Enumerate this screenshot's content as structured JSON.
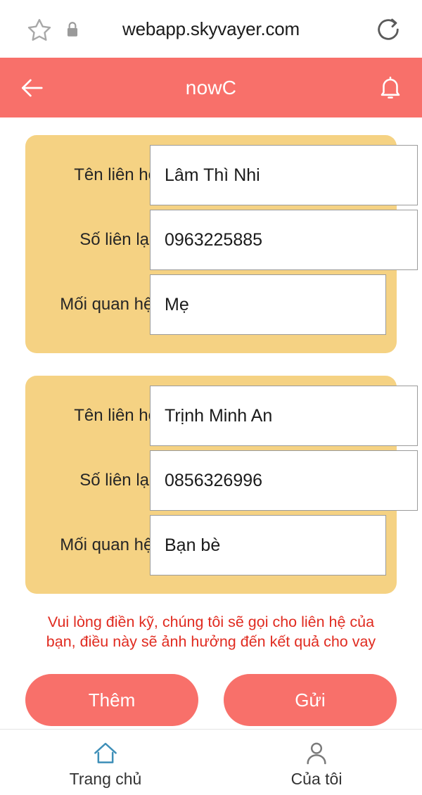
{
  "browser": {
    "url": "webapp.skyvayer.com",
    "star_icon": "star-outline-icon",
    "lock_icon": "lock-icon",
    "reload_icon": "reload-icon"
  },
  "header": {
    "title": "nowC",
    "back_icon": "back-arrow-icon",
    "bell_icon": "bell-icon",
    "background": "#f8706a"
  },
  "cards": [
    {
      "fields": [
        {
          "label": "Tên liên hệ",
          "value": "Lâm Thì Nhi"
        },
        {
          "label": "Số liên lạc",
          "value": "0963225885"
        },
        {
          "label": "Mối quan hệ:",
          "value": "Mẹ"
        }
      ]
    },
    {
      "fields": [
        {
          "label": "Tên liên hệ",
          "value": "Trịnh Minh An"
        },
        {
          "label": "Số liên lạc",
          "value": "0856326996"
        },
        {
          "label": "Mối quan hệ:",
          "value": "Bạn bè"
        }
      ]
    }
  ],
  "warning": {
    "line1": "Vui lòng điền kỹ, chúng tôi sẽ gọi cho liên hệ của",
    "line2": "bạn, điều này sẽ ảnh hưởng đến kết quả cho vay",
    "color": "#e02b20"
  },
  "actions": {
    "add_label": "Thêm",
    "send_label": "Gửi",
    "color": "#f8706a"
  },
  "bottom_nav": {
    "items": [
      {
        "label": "Trang chủ",
        "icon": "home-icon",
        "color": "#3e8fb8"
      },
      {
        "label": "Của tôi",
        "icon": "person-icon",
        "color": "#7a7a7a"
      }
    ]
  },
  "theme": {
    "card_background": "#f5d283",
    "accent": "#f8706a"
  }
}
